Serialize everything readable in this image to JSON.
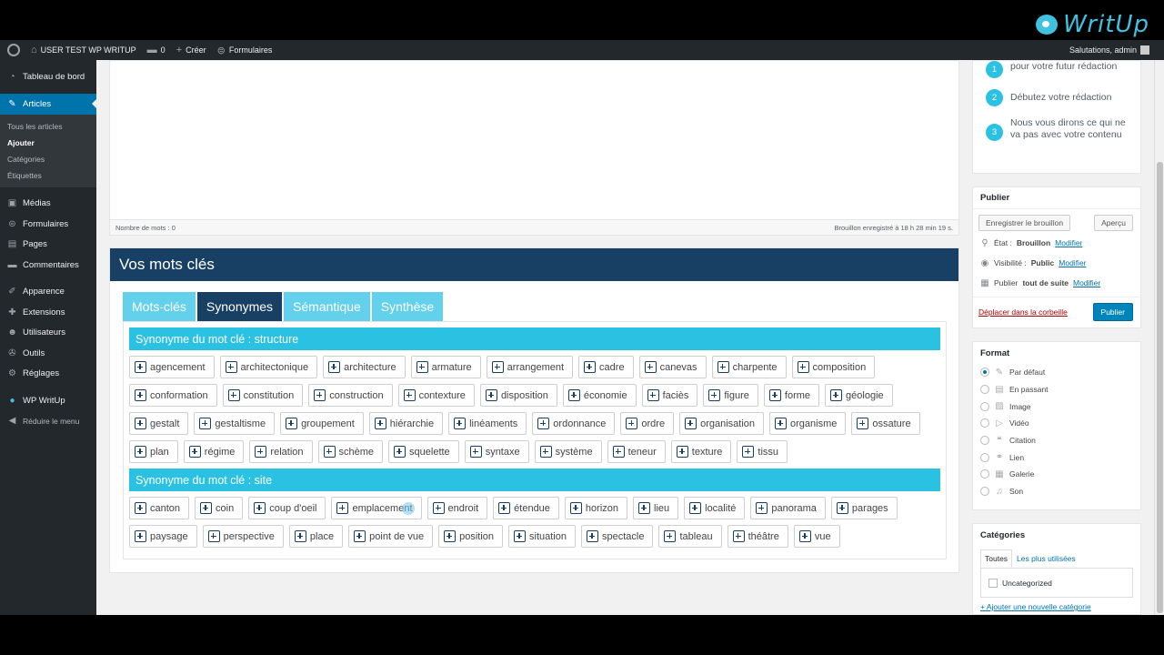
{
  "brand": {
    "name": "WritUp",
    "color": "#3fc1e0"
  },
  "adminbar": {
    "site_name": "USER TEST WP WRITUP",
    "comments_count": "0",
    "new_label": "Créer",
    "forms_label": "Formulaires",
    "greeting": "Salutations, admin"
  },
  "sidebar": {
    "dashboard": "Tableau de bord",
    "articles": "Articles",
    "articles_sub": [
      "Tous les articles",
      "Ajouter",
      "Catégories",
      "Étiquettes"
    ],
    "media": "Médias",
    "forms": "Formulaires",
    "pages": "Pages",
    "comments": "Commentaires",
    "appearance": "Apparence",
    "extensions": "Extensions",
    "users": "Utilisateurs",
    "tools": "Outils",
    "settings": "Réglages",
    "writup": "WP WritUp",
    "collapse": "Réduire le menu"
  },
  "editor": {
    "word_count": "Nombre de mots : 0",
    "draft_saved": "Brouillon enregistré à 18 h 28 min 19 s."
  },
  "keywords": {
    "title": "Vos mots clés",
    "tabs": [
      "Mots-clés",
      "Synonymes",
      "Sémantique",
      "Synthèse"
    ],
    "active_tab": "Synonymes",
    "sections": [
      {
        "title": "Synonyme du mot clé : structure",
        "words": [
          "agencement",
          "architectonique",
          "architecture",
          "armature",
          "arrangement",
          "cadre",
          "canevas",
          "charpente",
          "composition",
          "conformation",
          "constitution",
          "construction",
          "contexture",
          "disposition",
          "économie",
          "faciès",
          "figure",
          "forme",
          "géologie",
          "gestalt",
          "gestaltisme",
          "groupement",
          "hiérarchie",
          "linéaments",
          "ordonnance",
          "ordre",
          "organisation",
          "organisme",
          "ossature",
          "plan",
          "régime",
          "relation",
          "schème",
          "squelette",
          "syntaxe",
          "système",
          "teneur",
          "texture",
          "tissu"
        ]
      },
      {
        "title": "Synonyme du mot clé : site",
        "words": [
          "canton",
          "coin",
          "coup d'oeil",
          "emplacement",
          "endroit",
          "étendue",
          "horizon",
          "lieu",
          "localité",
          "panorama",
          "parages",
          "paysage",
          "perspective",
          "place",
          "point de vue",
          "position",
          "situation",
          "spectacle",
          "tableau",
          "théâtre",
          "vue"
        ]
      }
    ]
  },
  "steps": {
    "items": [
      {
        "num": "1",
        "text": "pour votre futur rédaction"
      },
      {
        "num": "2",
        "text": "Débutez votre rédaction"
      },
      {
        "num": "3",
        "text": "Nous vous dirons ce qui ne va pas avec votre contenu"
      }
    ]
  },
  "publish": {
    "title": "Publier",
    "save_draft": "Enregistrer le brouillon",
    "preview": "Aperçu",
    "status_label": "État :",
    "status_value": "Brouillon",
    "visibility_label": "Visibilité :",
    "visibility_value": "Public",
    "publish_label": "Publier",
    "publish_value": "tout de suite",
    "modify": "Modifier",
    "trash": "Déplacer dans la corbeille",
    "publish_button": "Publier"
  },
  "format": {
    "title": "Format",
    "options": [
      "Par défaut",
      "En passant",
      "Image",
      "Vidéo",
      "Citation",
      "Lien",
      "Galerie",
      "Son"
    ],
    "selected": "Par défaut"
  },
  "categories": {
    "title": "Catégories",
    "tabs": [
      "Toutes",
      "Les plus utilisées"
    ],
    "items": [
      "Uncategorized"
    ],
    "add_link": "+ Ajouter une nouvelle catégorie"
  }
}
